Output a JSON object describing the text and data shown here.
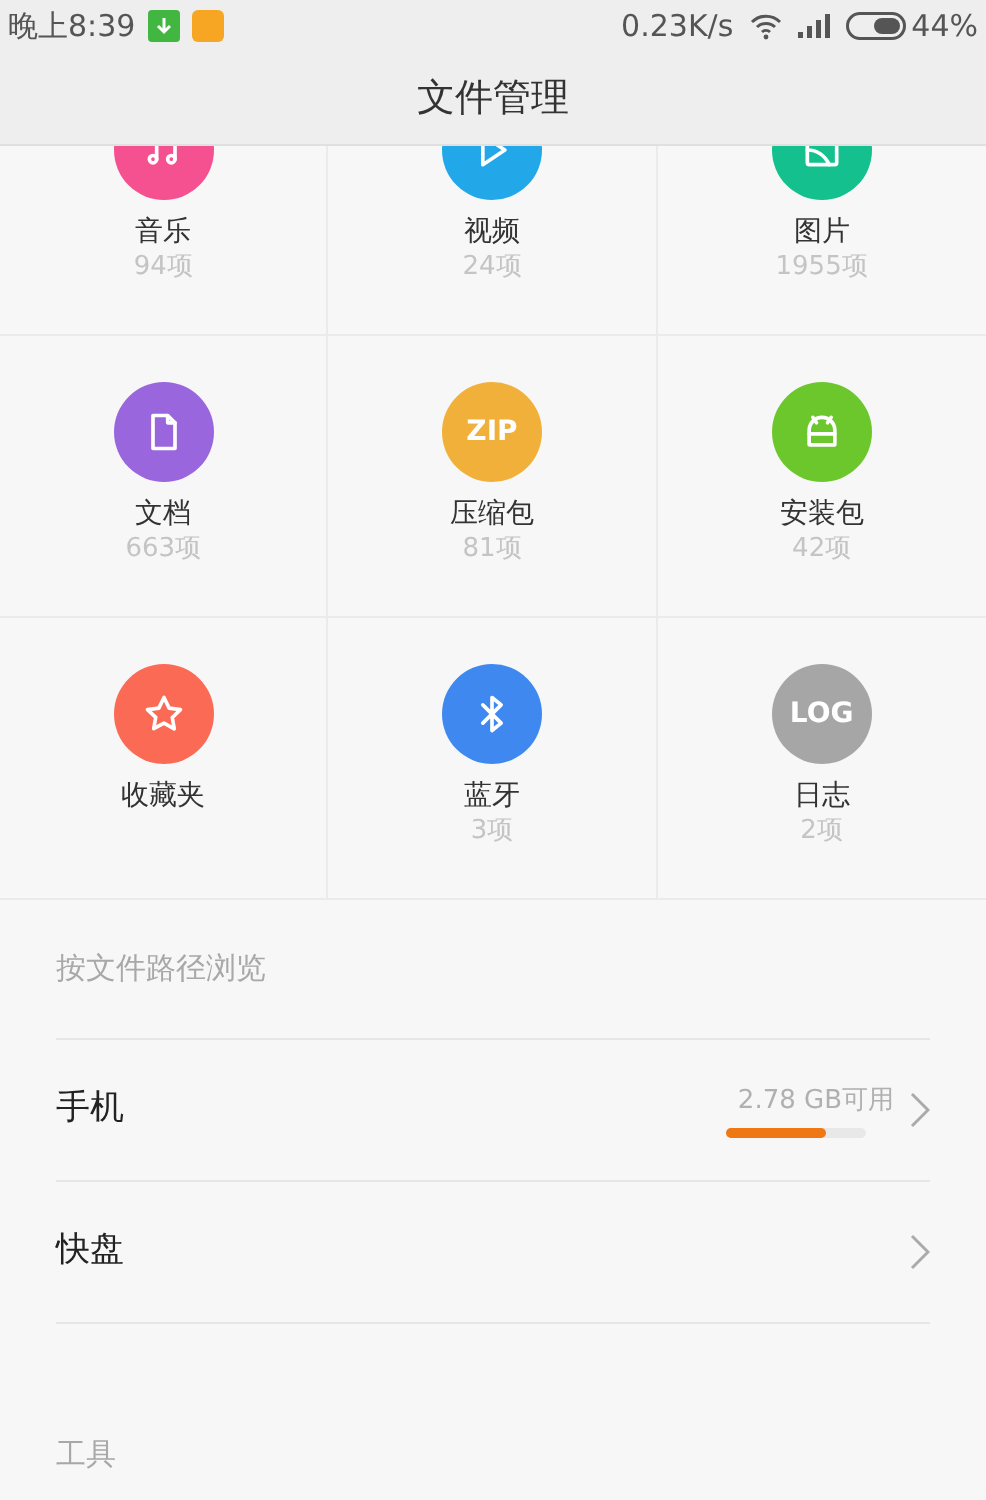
{
  "status_bar": {
    "time": "晚上8:39",
    "speed": "0.23K/s",
    "battery": "44%"
  },
  "header": {
    "title": "文件管理"
  },
  "categories": [
    {
      "kind": "music",
      "name": "音乐",
      "count": "94项",
      "color": "#f5508f"
    },
    {
      "kind": "video",
      "name": "视频",
      "count": "24项",
      "color": "#22a8e8"
    },
    {
      "kind": "image",
      "name": "图片",
      "count": "1955项",
      "color": "#13c08e"
    },
    {
      "kind": "document",
      "name": "文档",
      "count": "663项",
      "color": "#9966dd"
    },
    {
      "kind": "text",
      "badge": "ZIP",
      "name": "压缩包",
      "count": "81项",
      "color": "#f0b03a"
    },
    {
      "kind": "apk",
      "name": "安装包",
      "count": "42项",
      "color": "#6cc72d"
    },
    {
      "kind": "favorite",
      "name": "收藏夹",
      "color": "#fb6a55"
    },
    {
      "kind": "bluetooth",
      "name": "蓝牙",
      "count": "3项",
      "color": "#3f88f0"
    },
    {
      "kind": "text",
      "badge": "LOG",
      "name": "日志",
      "count": "2项",
      "color": "#a6a6a6"
    }
  ],
  "browse_section": {
    "title": "按文件路径浏览",
    "items": [
      {
        "name": "手机",
        "storage": "2.78 GB可用",
        "level": 0.71
      },
      {
        "name": "快盘"
      }
    ]
  },
  "tools_section": {
    "title": "工具"
  }
}
